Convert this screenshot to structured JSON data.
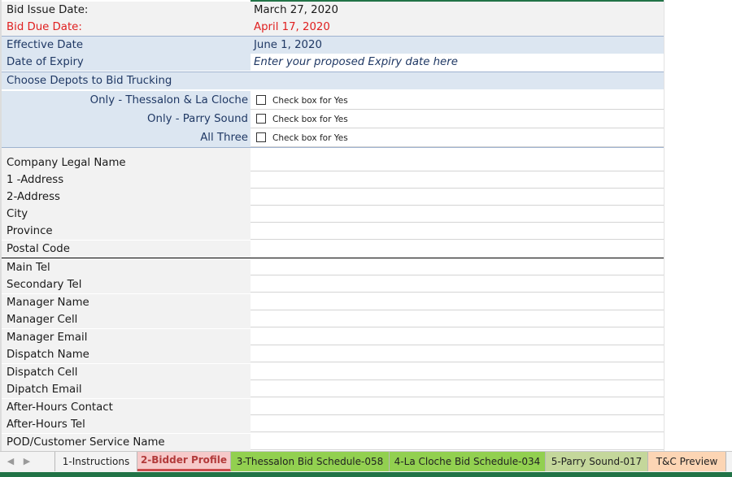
{
  "header": {
    "bid_issue_label": "Bid Issue Date:",
    "bid_issue_value": "March 27, 2020",
    "bid_due_label": "Bid Due Date:",
    "bid_due_value": "April 17, 2020",
    "effective_label": "Effective Date",
    "effective_value": "June 1, 2020",
    "expiry_label": "Date of Expiry",
    "expiry_value": "Enter your proposed Expiry date here"
  },
  "depots": {
    "title": "Choose Depots to Bid Trucking",
    "options": [
      {
        "label": "Only - Thessalon & La Cloche",
        "checkbox_text": "Check box for Yes",
        "checked": false
      },
      {
        "label": "Only - Parry Sound",
        "checkbox_text": "Check box for Yes",
        "checked": false
      },
      {
        "label": "All Three",
        "checkbox_text": "Check box for Yes",
        "checked": false
      }
    ]
  },
  "company_fields": [
    "Company Legal Name",
    "1 -Address",
    "2-Address",
    "City",
    "Province",
    "Postal Code"
  ],
  "contact_fields": [
    "Main Tel",
    "Secondary Tel",
    "Manager Name",
    "Manager Cell",
    "Manager Email",
    "Dispatch Name",
    "Dispatch Cell",
    "Dipatch Email",
    "After-Hours Contact",
    "After-Hours Tel",
    "POD/Customer Service  Name"
  ],
  "tabs": {
    "nav_prev": "◀",
    "nav_next": "▶",
    "items": [
      {
        "label": "1-Instructions"
      },
      {
        "label": "2-Bidder Profile"
      },
      {
        "label": "3-Thessalon Bid Schedule-058"
      },
      {
        "label": "4-La Cloche Bid Schedule-034"
      },
      {
        "label": "5-Parry Sound-017"
      },
      {
        "label": "T&C Preview"
      }
    ]
  },
  "colors": {
    "blue_fill": "#dce6f1",
    "red_text": "#e02020",
    "excel_green": "#217346",
    "tab_green": "#92d050",
    "tab_olive": "#c4d79b",
    "tab_peach": "#fcd5b4"
  }
}
